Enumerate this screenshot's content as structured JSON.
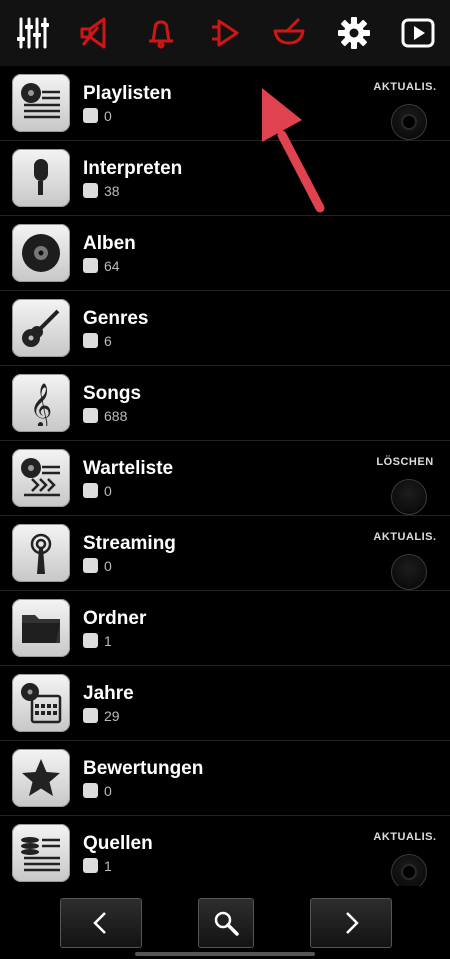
{
  "toolbar": {
    "icons": [
      "equalizer-icon",
      "speaker-icon",
      "bell-icon",
      "forward-icon",
      "bowl-icon",
      "gear-icon",
      "play-box-icon"
    ],
    "accent_color": "#d01515"
  },
  "rows": [
    {
      "title": "Playlisten",
      "count": "0",
      "icon": "playlist-icon",
      "action": "AKTUALIS."
    },
    {
      "title": "Interpreten",
      "count": "38",
      "icon": "microphone-icon"
    },
    {
      "title": "Alben",
      "count": "64",
      "icon": "disc-icon"
    },
    {
      "title": "Genres",
      "count": "6",
      "icon": "guitar-icon"
    },
    {
      "title": "Songs",
      "count": "688",
      "icon": "treble-clef-icon"
    },
    {
      "title": "Warteliste",
      "count": "0",
      "icon": "queue-icon",
      "action": "LÖSCHEN"
    },
    {
      "title": "Streaming",
      "count": "0",
      "icon": "antenna-icon",
      "action": "AKTUALIS."
    },
    {
      "title": "Ordner",
      "count": "1",
      "icon": "folder-icon"
    },
    {
      "title": "Jahre",
      "count": "29",
      "icon": "calendar-icon"
    },
    {
      "title": "Bewertungen",
      "count": "0",
      "icon": "star-icon"
    },
    {
      "title": "Quellen",
      "count": "1",
      "icon": "sources-icon",
      "action": "AKTUALIS."
    }
  ],
  "bottom_nav": {
    "back": "chevron-left-icon",
    "search": "search-icon",
    "forward": "chevron-right-icon"
  },
  "annotation": {
    "color": "#e0424f"
  }
}
